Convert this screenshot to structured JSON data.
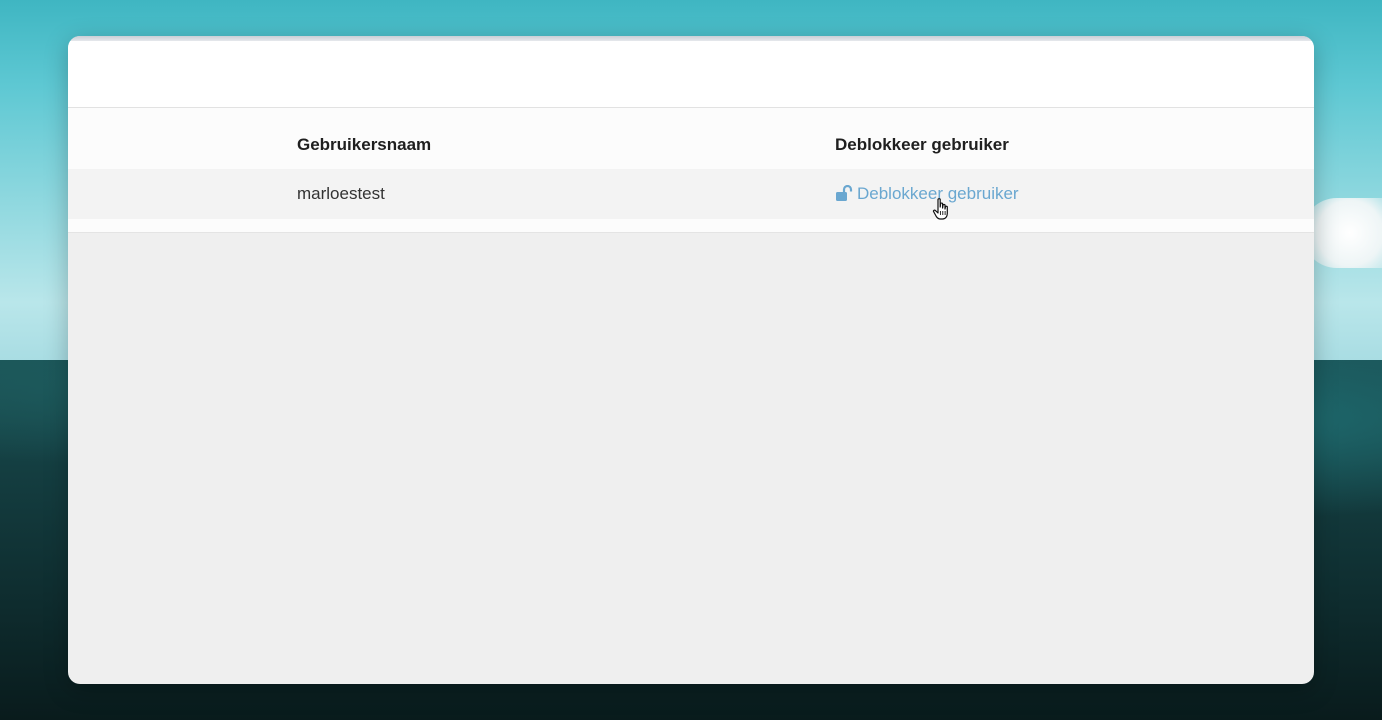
{
  "table": {
    "headers": {
      "username": "Gebruikersnaam",
      "unblock": "Deblokkeer gebruiker"
    },
    "rows": [
      {
        "username": "marloestest",
        "action_label": "Deblokkeer gebruiker",
        "action_icon": "unlock-icon"
      }
    ]
  },
  "colors": {
    "link": "#6aa7d0",
    "window_background": "#efefef",
    "header_text": "#1f1f1f"
  }
}
